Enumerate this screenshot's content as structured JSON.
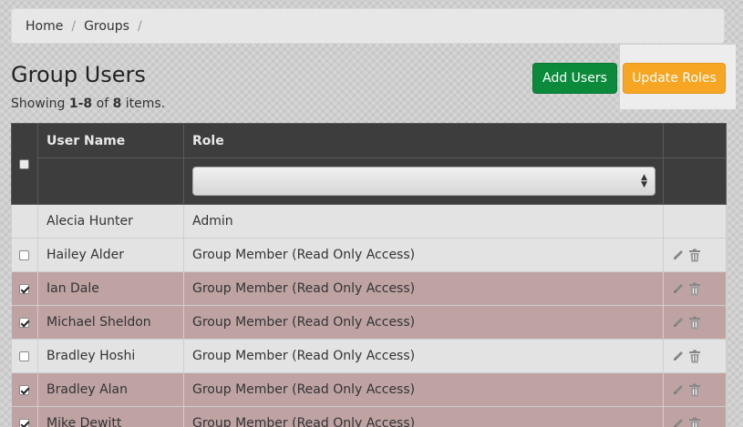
{
  "breadcrumb": {
    "items": [
      "Home",
      "Groups"
    ],
    "separator": "/"
  },
  "page": {
    "title": "Group Users",
    "summary_prefix": "Showing ",
    "summary_range": "1-8",
    "summary_mid": " of ",
    "summary_total": "8",
    "summary_suffix": " items."
  },
  "toolbar": {
    "add_label": "Add Users",
    "update_label": "Update Roles"
  },
  "table": {
    "columns": {
      "username": "User Name",
      "role": "Role"
    },
    "role_filter_value": "",
    "rows": [
      {
        "name": "Alecia Hunter",
        "role": "Admin",
        "checkbox": "none",
        "actions": false
      },
      {
        "name": "Hailey Alder",
        "role": "Group Member (Read Only Access)",
        "checkbox": "unchecked",
        "actions": true
      },
      {
        "name": "Ian Dale",
        "role": "Group Member (Read Only Access)",
        "checkbox": "checked",
        "actions": true
      },
      {
        "name": "Michael Sheldon",
        "role": "Group Member (Read Only Access)",
        "checkbox": "checked",
        "actions": true
      },
      {
        "name": "Bradley Hoshi",
        "role": "Group Member (Read Only Access)",
        "checkbox": "unchecked",
        "actions": true
      },
      {
        "name": "Bradley Alan",
        "role": "Group Member (Read Only Access)",
        "checkbox": "checked",
        "actions": true
      },
      {
        "name": "Mike Dewitt",
        "role": "Group Member (Read Only Access)",
        "checkbox": "checked",
        "actions": true
      }
    ]
  },
  "icons": {
    "edit": "pencil-icon",
    "delete": "trash-icon"
  },
  "colors": {
    "add_button": "#0b8a3c",
    "update_button": "#f6a623",
    "header_bg": "#3d3d3d",
    "selected_row": "#bfa3a3"
  }
}
